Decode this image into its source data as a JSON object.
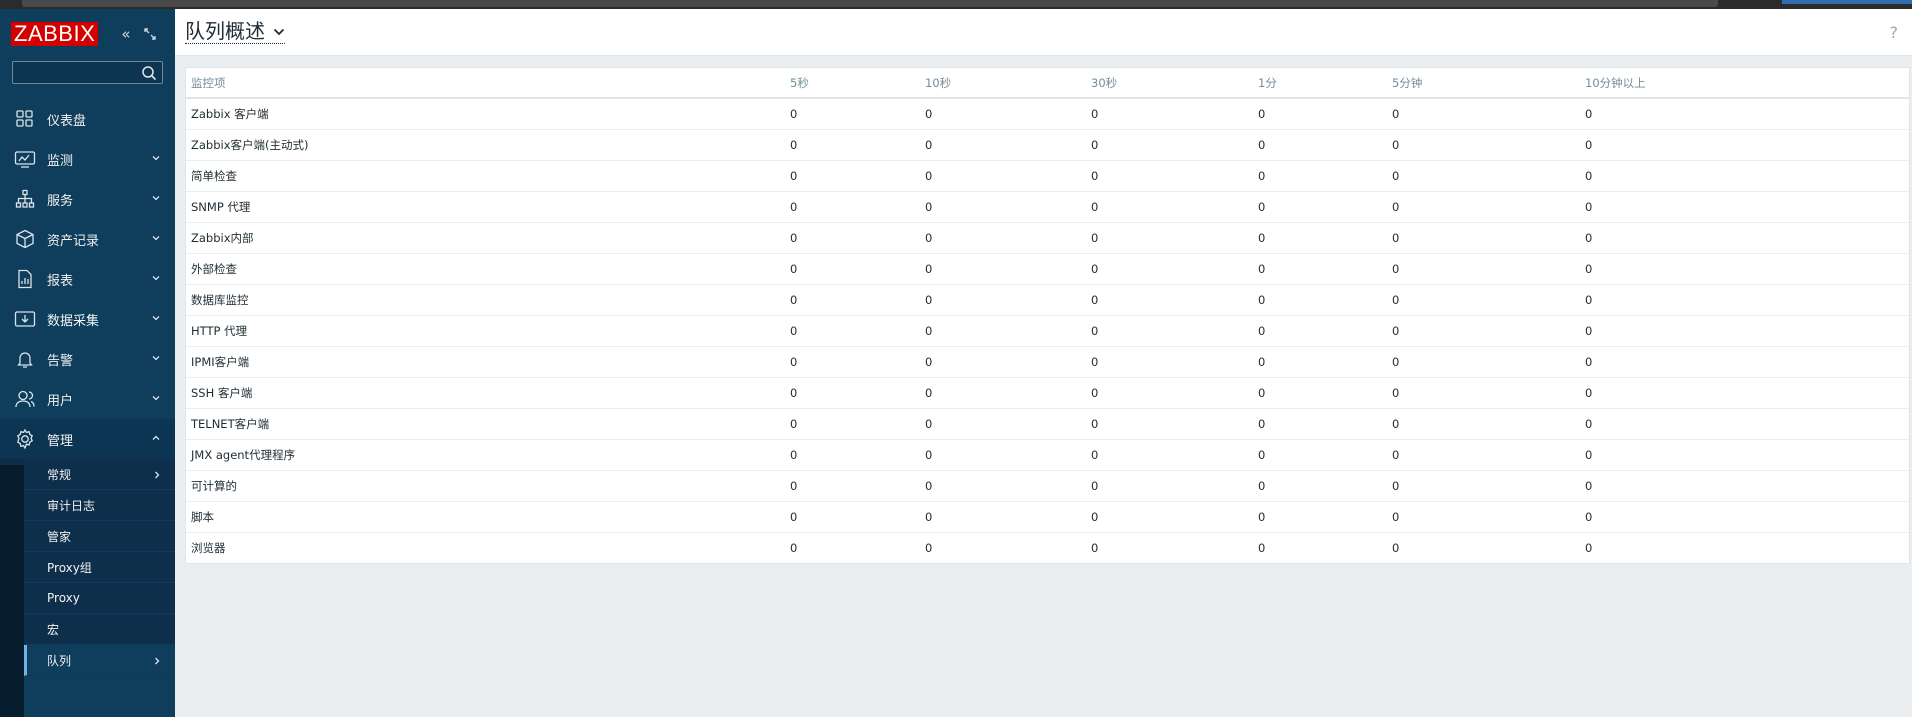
{
  "app": {
    "logo": "ZABBIX"
  },
  "sidebar": {
    "search_placeholder": "",
    "menu": [
      {
        "label": "仪表盘",
        "icon": "dashboard-icon",
        "expandable": false
      },
      {
        "label": "监测",
        "icon": "monitoring-icon",
        "expandable": true
      },
      {
        "label": "服务",
        "icon": "services-icon",
        "expandable": true
      },
      {
        "label": "资产记录",
        "icon": "inventory-icon",
        "expandable": true
      },
      {
        "label": "报表",
        "icon": "reports-icon",
        "expandable": true
      },
      {
        "label": "数据采集",
        "icon": "data-collection-icon",
        "expandable": true
      },
      {
        "label": "告警",
        "icon": "alerts-icon",
        "expandable": true
      },
      {
        "label": "用户",
        "icon": "users-icon",
        "expandable": true
      },
      {
        "label": "管理",
        "icon": "gear-icon",
        "expandable": true,
        "expanded": true
      }
    ],
    "submenu": [
      {
        "label": "常规",
        "has_children": true
      },
      {
        "label": "审计日志",
        "has_children": false
      },
      {
        "label": "管家",
        "has_children": false
      },
      {
        "label": "Proxy组",
        "has_children": false
      },
      {
        "label": "Proxy",
        "has_children": false
      },
      {
        "label": "宏",
        "has_children": false
      },
      {
        "label": "队列",
        "has_children": true,
        "selected": true
      }
    ]
  },
  "header": {
    "title": "队列概述",
    "help": "?"
  },
  "table": {
    "columns": [
      "监控项",
      "5秒",
      "10秒",
      "30秒",
      "1分",
      "5分钟",
      "10分钟以上"
    ],
    "rows": [
      [
        "Zabbix 客户端",
        "0",
        "0",
        "0",
        "0",
        "0",
        "0"
      ],
      [
        "Zabbix客户端(主动式)",
        "0",
        "0",
        "0",
        "0",
        "0",
        "0"
      ],
      [
        "简单检查",
        "0",
        "0",
        "0",
        "0",
        "0",
        "0"
      ],
      [
        "SNMP 代理",
        "0",
        "0",
        "0",
        "0",
        "0",
        "0"
      ],
      [
        "Zabbix内部",
        "0",
        "0",
        "0",
        "0",
        "0",
        "0"
      ],
      [
        "外部检查",
        "0",
        "0",
        "0",
        "0",
        "0",
        "0"
      ],
      [
        "数据库监控",
        "0",
        "0",
        "0",
        "0",
        "0",
        "0"
      ],
      [
        "HTTP 代理",
        "0",
        "0",
        "0",
        "0",
        "0",
        "0"
      ],
      [
        "IPMI客户端",
        "0",
        "0",
        "0",
        "0",
        "0",
        "0"
      ],
      [
        "SSH 客户端",
        "0",
        "0",
        "0",
        "0",
        "0",
        "0"
      ],
      [
        "TELNET客户端",
        "0",
        "0",
        "0",
        "0",
        "0",
        "0"
      ],
      [
        "JMX agent代理程序",
        "0",
        "0",
        "0",
        "0",
        "0",
        "0"
      ],
      [
        "可计算的",
        "0",
        "0",
        "0",
        "0",
        "0",
        "0"
      ],
      [
        "脚本",
        "0",
        "0",
        "0",
        "0",
        "0",
        "0"
      ],
      [
        "浏览器",
        "0",
        "0",
        "0",
        "0",
        "0",
        "0"
      ]
    ]
  },
  "colors": {
    "sidebar_bg": "#0f3d5c",
    "logo_bg": "#d40000",
    "selected_marker": "#6fb3e6"
  }
}
